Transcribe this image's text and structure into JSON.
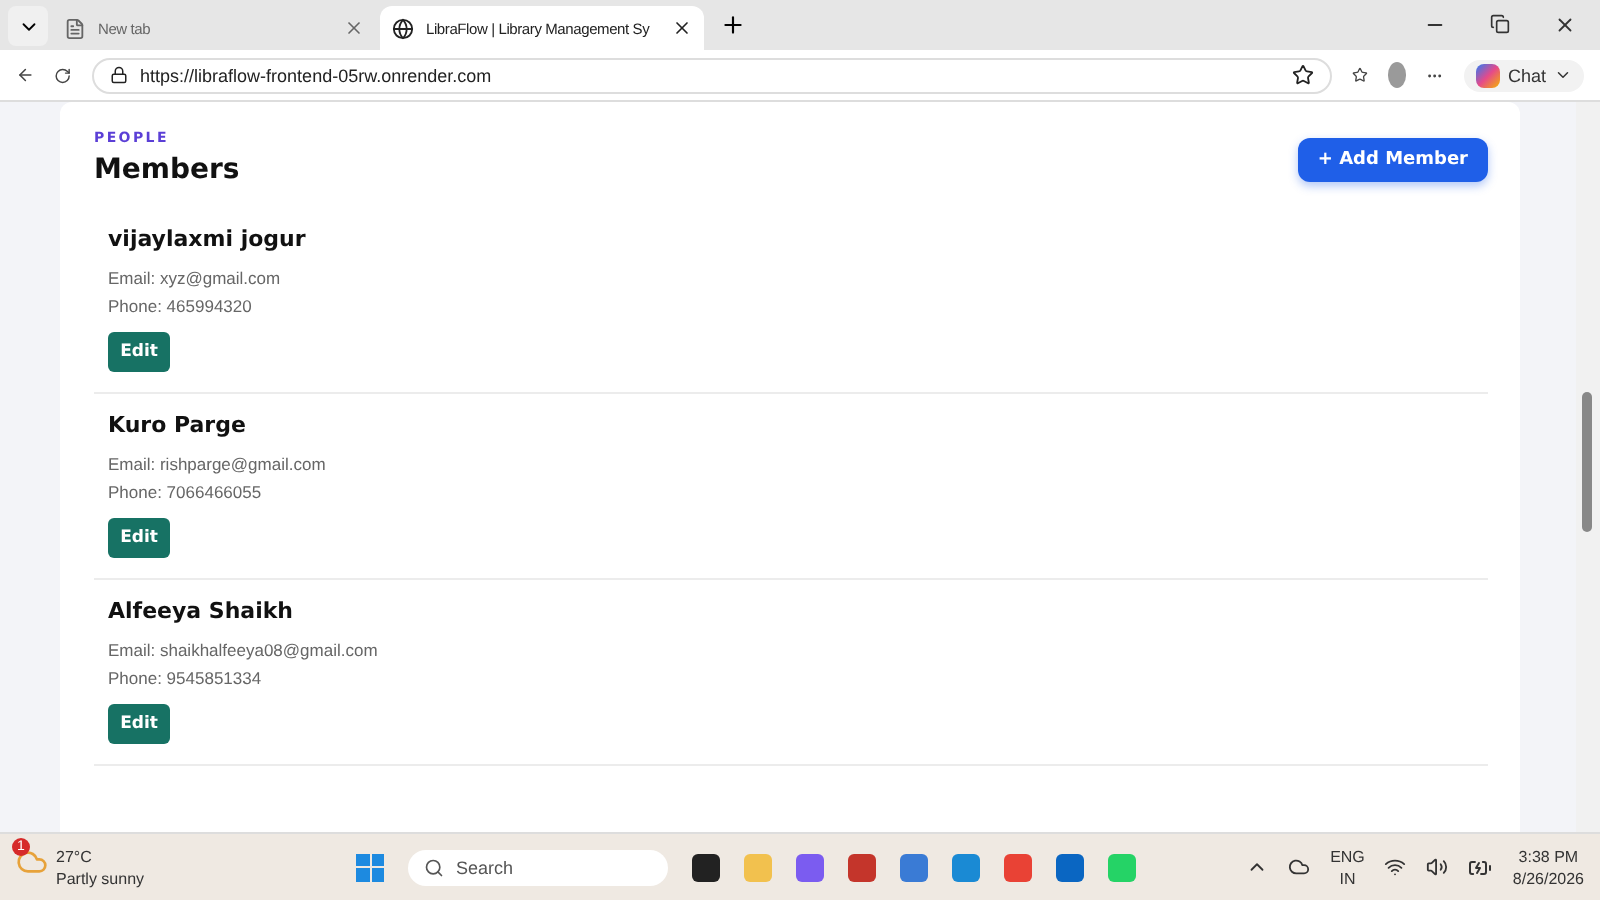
{
  "browser": {
    "tabs": [
      {
        "title": "New tab",
        "selected": false
      },
      {
        "title": "LibraFlow | Library Management Sy",
        "selected": true
      }
    ],
    "url": "https://libraflow-frontend-05rw.onrender.com",
    "chat_label": "Chat"
  },
  "page": {
    "eyebrow": "PEOPLE",
    "title": "Members",
    "add_button": "+ Add Member",
    "members": [
      {
        "name": "vijaylaxmi jogur",
        "email": "Email: xyz@gmail.com",
        "phone": "Phone: 465994320",
        "action": "Edit"
      },
      {
        "name": "Kuro Parge",
        "email": "Email: rishparge@gmail.com",
        "phone": "Phone: 7066466055",
        "action": "Edit"
      },
      {
        "name": "Alfeeya Shaikh",
        "email": "Email: shaikhalfeeya08@gmail.com",
        "phone": "Phone: 9545851334",
        "action": "Edit"
      }
    ]
  },
  "taskbar": {
    "weather": {
      "badge": "1",
      "temp": "27°C",
      "condition": "Partly sunny"
    },
    "search_placeholder": "Search",
    "language": "ENG",
    "region": "IN",
    "time": "3:38 PM",
    "date": "8/26/2026"
  }
}
